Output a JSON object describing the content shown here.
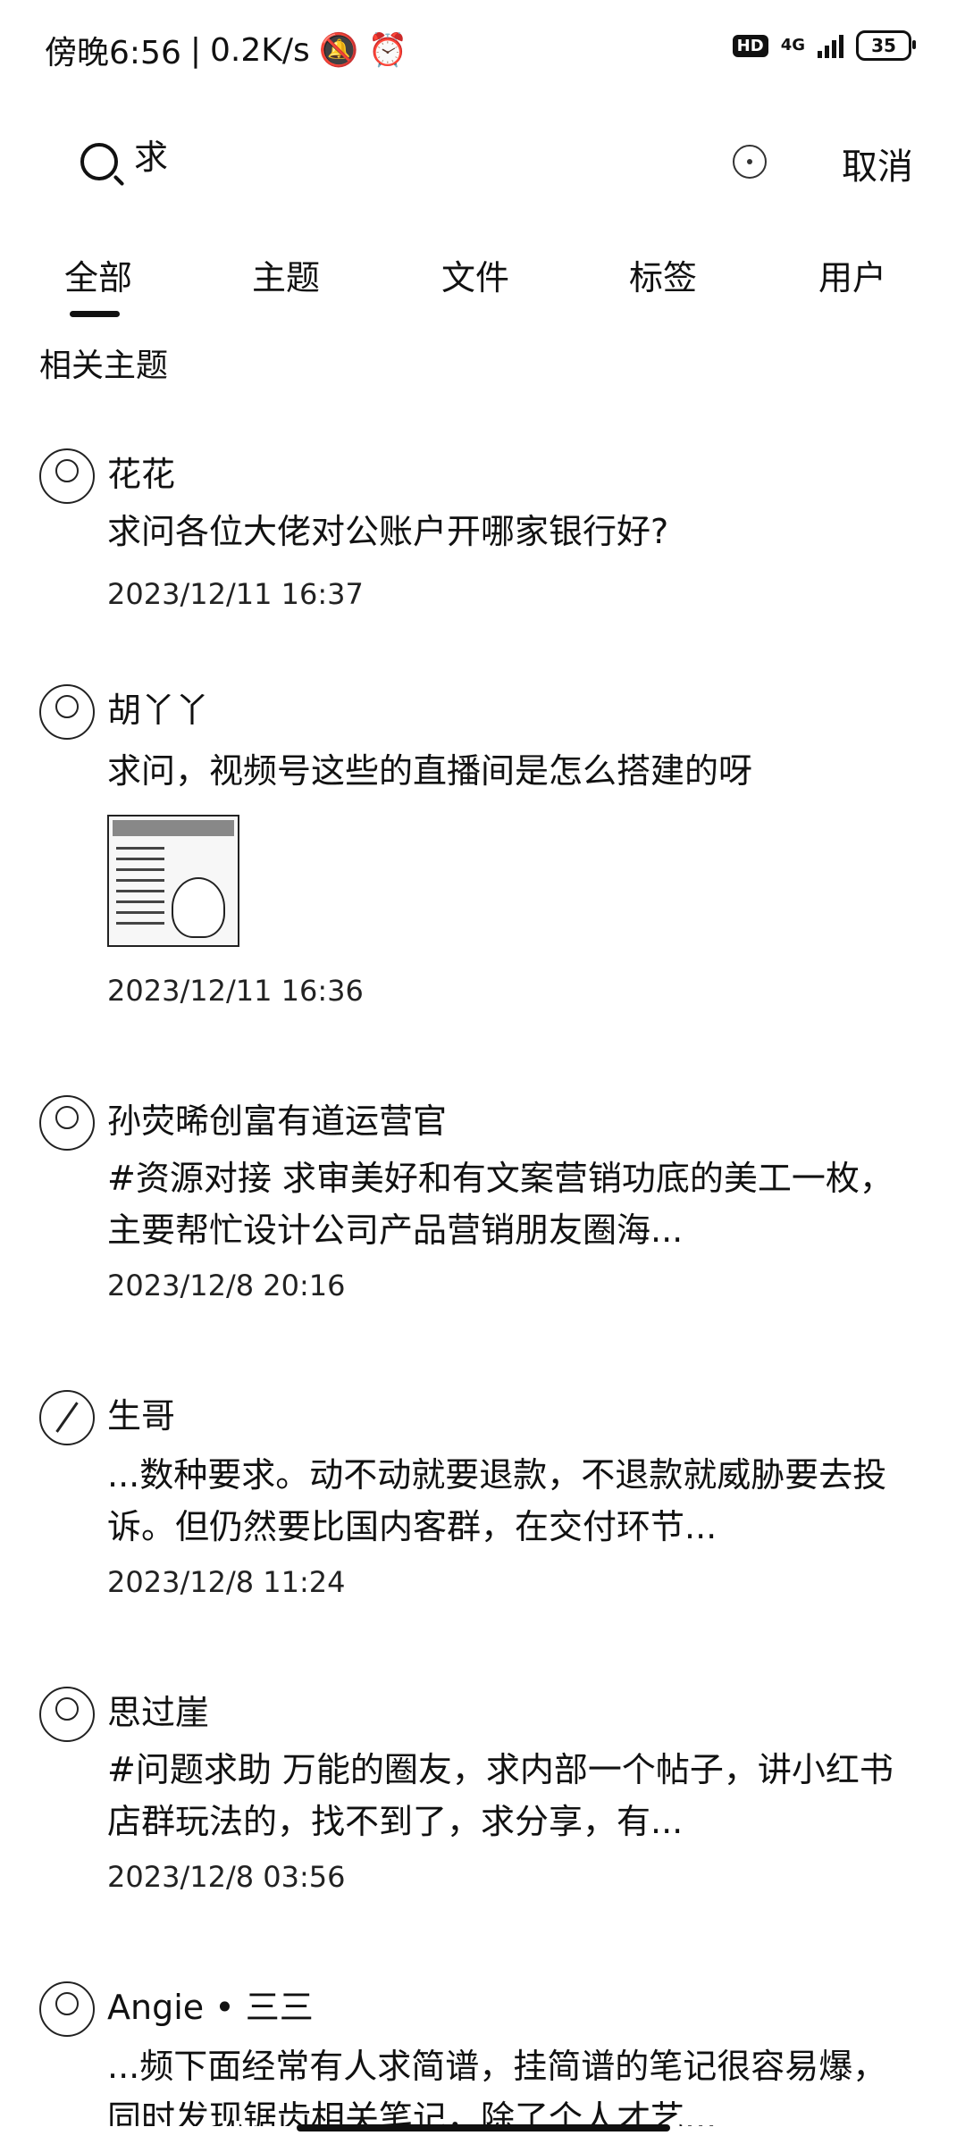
{
  "status_bar": {
    "time": "傍晚6:56",
    "speed": "0.2K/s",
    "hd": "HD",
    "network": "4G",
    "battery": "35"
  },
  "search": {
    "query": "求",
    "cancel_label": "取消"
  },
  "tabs": [
    {
      "label": "全部",
      "active": true
    },
    {
      "label": "主题"
    },
    {
      "label": "文件"
    },
    {
      "label": "标签"
    },
    {
      "label": "用户"
    }
  ],
  "section_title": "相关主题",
  "results": [
    {
      "author": "花花",
      "text": "求问各位大佬对公账户开哪家银行好?",
      "date": "2023/12/11 16:37"
    },
    {
      "author": "胡丫丫",
      "text": "求问，视频号这些的直播间是怎么搭建的呀",
      "date": "2023/12/11 16:36",
      "has_image": true
    },
    {
      "author": "孙荧晞创富有道运营官",
      "text": " #资源对接  求审美好和有文案营销功底的美工一枚，主要帮忙设计公司产品营销朋友圈海...",
      "date": "2023/12/8 20:16"
    },
    {
      "author": "生哥",
      "text": "...数种要求。动不动就要退款，不退款就威胁要去投诉。但仍然要比国内客群，在交付环节...",
      "date": "2023/12/8 11:24"
    },
    {
      "author": "思过崖",
      "text": " #问题求助  万能的圈友，求内部一个帖子，讲小红书店群玩法的，找不到了，求分享，有...",
      "date": "2023/12/8 03:56"
    },
    {
      "author": "Angie • 三三",
      "text": "...频下面经常有人求简谱，挂简谱的笔记很容易爆，同时发现锯齿相关笔记，除了个人才艺..."
    }
  ]
}
